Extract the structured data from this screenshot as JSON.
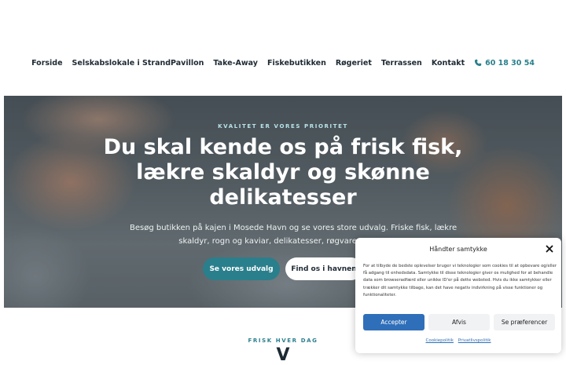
{
  "nav": {
    "items": [
      {
        "label": "Forside"
      },
      {
        "label": "Selskabslokale i StrandPavillon"
      },
      {
        "label": "Take-Away"
      },
      {
        "label": "Fiskebutikken"
      },
      {
        "label": "Røgeriet"
      },
      {
        "label": "Terrassen"
      },
      {
        "label": "Kontakt"
      }
    ],
    "phone": "60 18 30 54",
    "accent_color": "#2a7f8c"
  },
  "hero": {
    "eyebrow": "KVALITET ER VORES PRIORITET",
    "title_lines": [
      "Du skal kende os på frisk fisk,",
      "lækre skaldyr og skønne",
      "delikatesser"
    ],
    "text_lines": [
      "Besøg butikken på kajen i Mosede Havn og se vores store udvalg. Friske fisk, lækre",
      "skaldyr, rogn og kaviar, delikatesser, røgvarer og me"
    ],
    "primary_button": "Se vores udvalg",
    "secondary_button": "Find os i havnen"
  },
  "section": {
    "eyebrow": "FRISK HVER DAG",
    "heading": "V"
  },
  "cookie": {
    "title": "Håndter samtykke",
    "text_lines": [
      "For at tilbyde de bedste oplevelser bruger vi teknologier som cookies til at opbevare og/eller",
      "få adgang til enhedsdata. Samtykke til disse teknologier giver os mulighed for at behandle",
      "data som browseradfærd eller unikke ID'er på dette websted. Hvis du ikke samtykker eller",
      "trækker dit samtykke tilbage, kan det have negativ indvirkning på visse funktioner og",
      "funktionaliteter."
    ],
    "accept": "Accepter",
    "deny": "Afvis",
    "preferences": "Se præferencer",
    "links": [
      "Cookiepolitik",
      "Privatlivspolitik"
    ],
    "accent_color": "#2f6fb9"
  }
}
